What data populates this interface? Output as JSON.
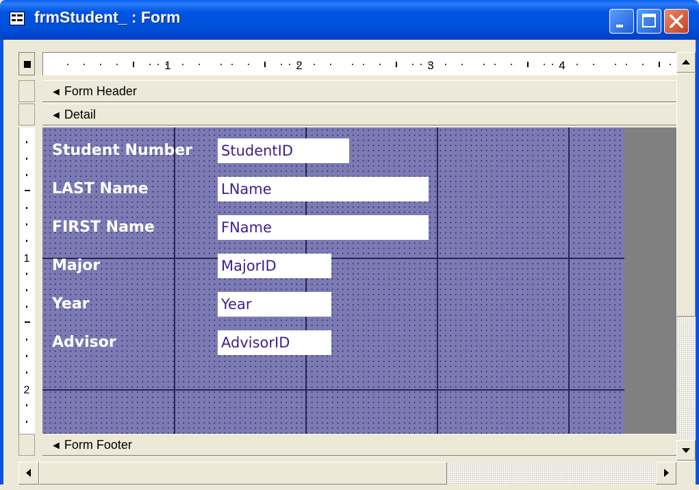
{
  "window": {
    "title": "frmStudent_ : Form",
    "icon": "form-view-icon",
    "titlebar_color": "#0054e3"
  },
  "caption_buttons": {
    "minimize_icon": "minimize-icon",
    "maximize_icon": "maximize-icon",
    "close_icon": "close-icon"
  },
  "ruler": {
    "horizontal_numbers": [
      "1",
      "2",
      "3",
      "4"
    ],
    "vertical_numbers": [
      "1",
      "2"
    ]
  },
  "sections": {
    "header": "Form Header",
    "detail": "Detail",
    "footer": "Form Footer"
  },
  "detail": {
    "background_color": "#7c7ab3",
    "controls": [
      {
        "label": "Student Number",
        "field": "StudentID"
      },
      {
        "label": "LAST Name",
        "field": "LName"
      },
      {
        "label": "FIRST Name",
        "field": "FName"
      },
      {
        "label": "Major",
        "field": "MajorID"
      },
      {
        "label": "Year",
        "field": "Year"
      },
      {
        "label": "Advisor",
        "field": "AdvisorID"
      }
    ]
  },
  "scrollbars": {
    "up_icon": "scroll-up-arrow-icon",
    "down_icon": "scroll-down-arrow-icon",
    "left_icon": "scroll-left-arrow-icon",
    "right_icon": "scroll-right-arrow-icon"
  }
}
